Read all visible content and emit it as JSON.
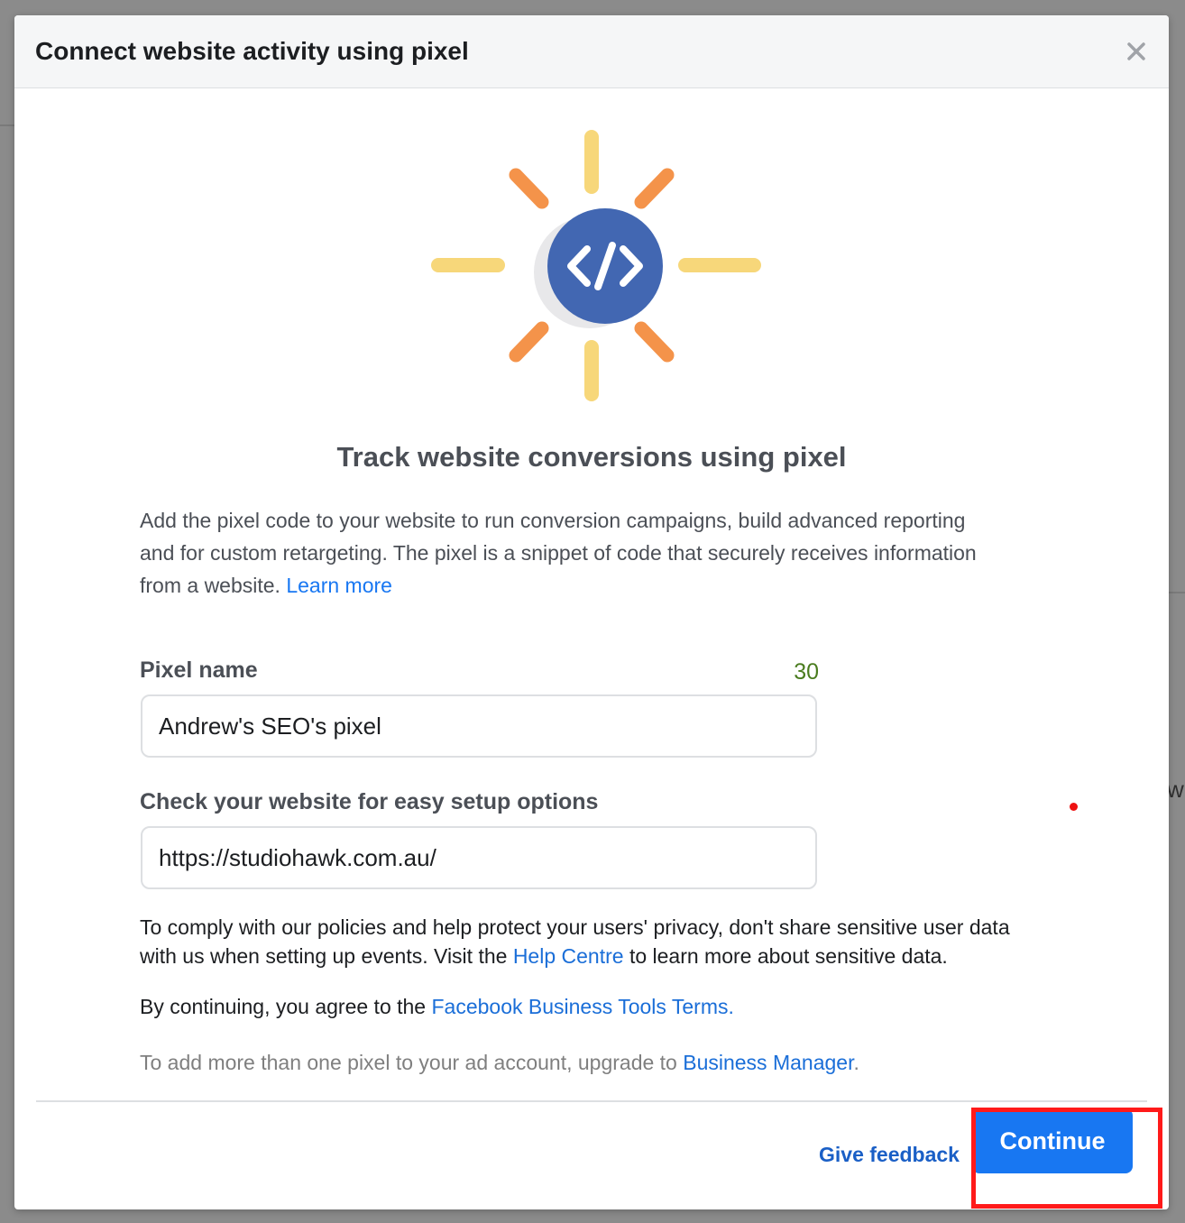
{
  "dialog": {
    "title": "Connect website activity using pixel",
    "close_icon": "close-icon"
  },
  "illustration": {
    "icon": "code-brackets-icon",
    "colors": {
      "circle": "#4267b2",
      "rays_yellow": "#f7d77a",
      "rays_orange": "#f4934a"
    }
  },
  "main": {
    "heading": "Track website conversions using pixel",
    "description": "Add the pixel code to your website to run conversion campaigns, build advanced reporting and for custom retargeting. The pixel is a snippet of code that securely receives information from a website.",
    "learn_more": "Learn more"
  },
  "form": {
    "pixel_name_label": "Pixel name",
    "pixel_name_count": "30",
    "pixel_name_value": "Andrew's SEO's pixel",
    "website_label": "Check your website for easy setup options",
    "website_value": "https://studiohawk.com.au/"
  },
  "notices": {
    "policy_before": "To comply with our policies and help protect your users' privacy, don't share sensitive user data with us when setting up events. Visit the",
    "help_centre": "Help Centre",
    "policy_after": "to learn more about sensitive data.",
    "terms_before": "By continuing, you agree to the",
    "terms_link": "Facebook Business Tools Terms.",
    "upgrade_before": "To add more than one pixel to your ad account, upgrade to",
    "upgrade_link": "Business Manager",
    "upgrade_after": "."
  },
  "footer": {
    "feedback_label": "Give feedback",
    "continue_label": "Continue"
  },
  "background": {
    "edge_text": "wi"
  },
  "colors": {
    "primary": "#1877f2",
    "link": "#1a6ed8",
    "highlight": "#ff1a1a",
    "counter": "#4a7c1f"
  }
}
